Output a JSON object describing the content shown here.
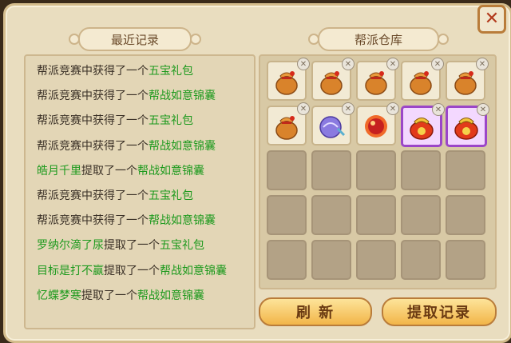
{
  "tabs": {
    "recent": "最近记录",
    "warehouse": "帮派仓库"
  },
  "log": [
    {
      "actor": "帮派竞赛中获得了一个",
      "actor_green": false,
      "item": "五宝礼包"
    },
    {
      "actor": "帮派竞赛中获得了一个",
      "actor_green": false,
      "item": "帮战如意锦囊"
    },
    {
      "actor": "帮派竞赛中获得了一个",
      "actor_green": false,
      "item": "五宝礼包"
    },
    {
      "actor": "帮派竞赛中获得了一个",
      "actor_green": false,
      "item": "帮战如意锦囊"
    },
    {
      "actor": "皓月千里",
      "actor_green": true,
      "mid": "提取了一个",
      "item": "帮战如意锦囊"
    },
    {
      "actor": "帮派竞赛中获得了一个",
      "actor_green": false,
      "item": "五宝礼包"
    },
    {
      "actor": "帮派竞赛中获得了一个",
      "actor_green": false,
      "item": "帮战如意锦囊"
    },
    {
      "actor": "罗纳尔滴了尿",
      "actor_green": true,
      "mid": "提取了一个",
      "item": "五宝礼包"
    },
    {
      "actor": "目标是打不赢",
      "actor_green": true,
      "mid": "提取了一个",
      "item": "帮战如意锦囊"
    },
    {
      "actor": "忆蝶梦寒",
      "actor_green": true,
      "mid": "提取了一个",
      "item": "帮战如意锦囊"
    }
  ],
  "slots": [
    "lucky-bag",
    "lucky-bag",
    "lucky-bag",
    "lucky-bag",
    "lucky-bag",
    "lucky-bag",
    "purple-pouch",
    "red-orb",
    "golden-bag-purple",
    "golden-bag-purple",
    "empty",
    "empty",
    "empty",
    "empty",
    "empty",
    "empty",
    "empty",
    "empty",
    "empty",
    "empty",
    "empty",
    "empty",
    "empty",
    "empty",
    "empty"
  ],
  "buttons": {
    "refresh": "刷 新",
    "extract_log": "提取记录"
  }
}
